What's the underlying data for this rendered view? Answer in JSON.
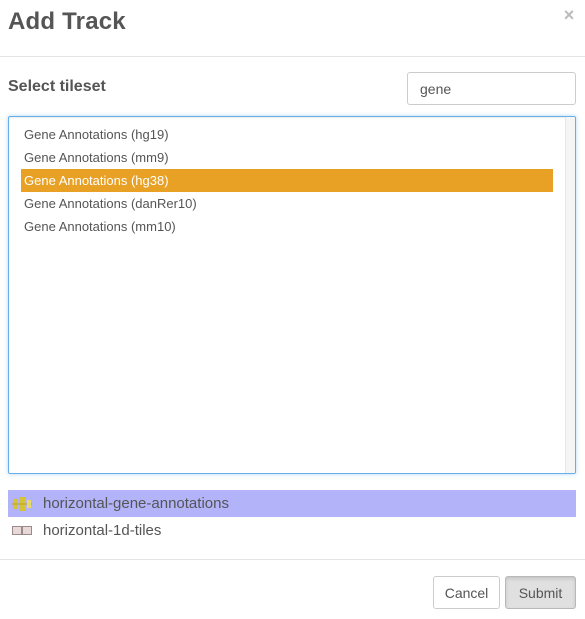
{
  "header": {
    "title": "Add Track",
    "close_glyph": "×"
  },
  "tileset": {
    "label": "Select tileset",
    "search_value": "gene",
    "items": [
      {
        "label": "Gene Annotations (hg19)"
      },
      {
        "label": "Gene Annotations (mm9)"
      },
      {
        "label": "Gene Annotations (hg38)",
        "selected": true
      },
      {
        "label": "Gene Annotations (danRer10)"
      },
      {
        "label": "Gene Annotations (mm10)"
      }
    ]
  },
  "track_types": [
    {
      "label": "horizontal-gene-annotations",
      "icon": "gene-annotations-icon",
      "selected": true
    },
    {
      "label": "horizontal-1d-tiles",
      "icon": "1d-tiles-icon",
      "selected": false
    }
  ],
  "footer": {
    "cancel_label": "Cancel",
    "submit_label": "Submit"
  },
  "colors": {
    "selected_tileset_bg": "#e8a125",
    "selected_track_type_bg": "#b3b3fa",
    "focus_border": "#66afe9"
  }
}
